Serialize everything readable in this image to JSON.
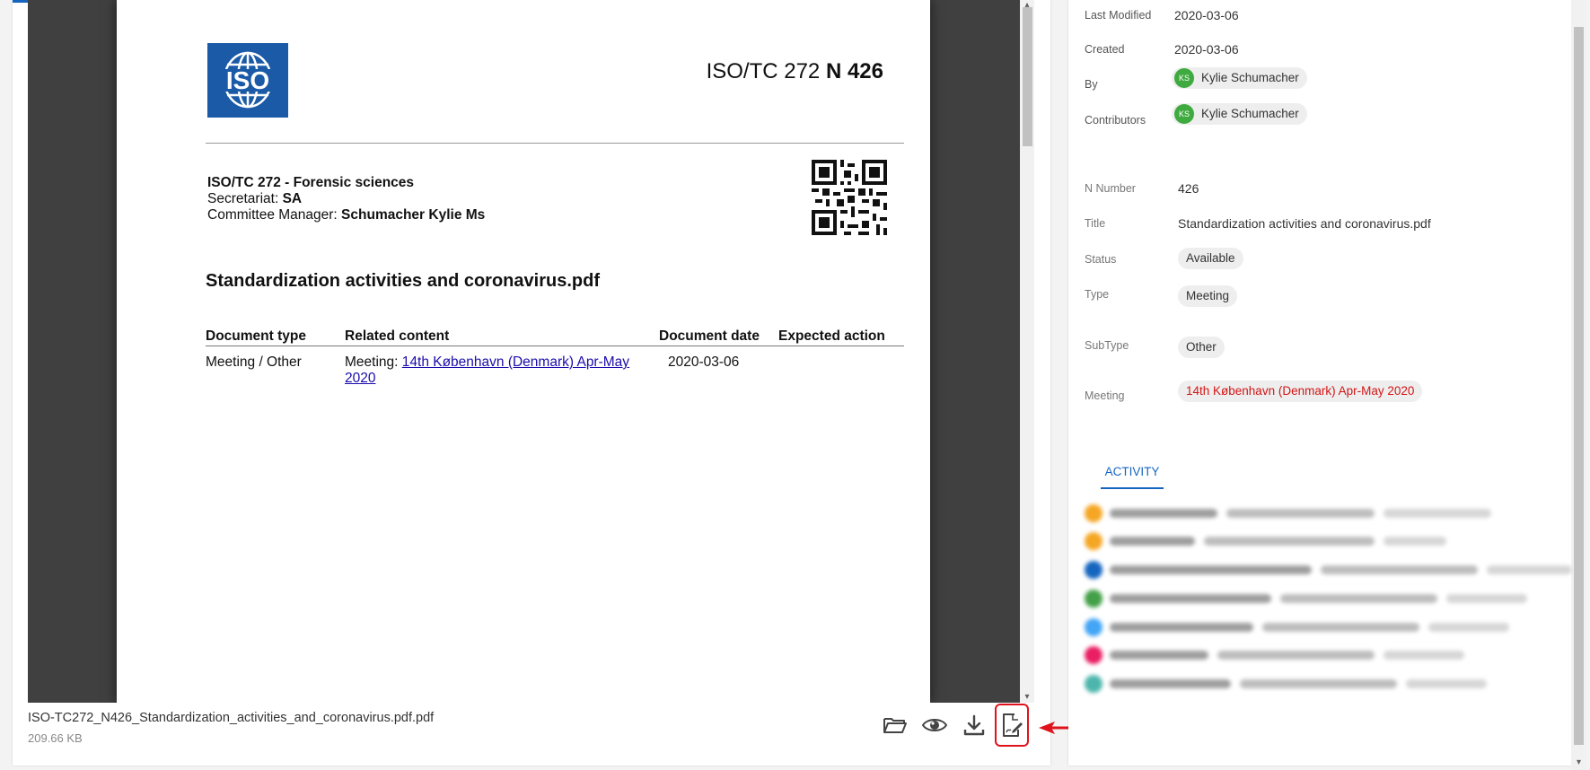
{
  "pdf": {
    "logo_text": "ISO",
    "doc_ref_prefix": "ISO/TC 272",
    "doc_ref_number": "N 426",
    "committee_line": "ISO/TC 272 - Forensic sciences",
    "secretariat_label": "Secretariat:",
    "secretariat_value": "SA",
    "manager_label": "Committee Manager:",
    "manager_value": "Schumacher Kylie Ms",
    "title": "Standardization activities and coronavirus.pdf",
    "table": {
      "headers": [
        "Document type",
        "Related content",
        "Document date",
        "Expected action"
      ],
      "row": {
        "doc_type": "Meeting / Other",
        "related_prefix": "Meeting:",
        "related_link": "14th København (Denmark) Apr-May 2020",
        "doc_date": "2020-03-06",
        "expected_action": ""
      }
    }
  },
  "file": {
    "name": "ISO-TC272_N426_Standardization_activities_and_coronavirus.pdf.pdf",
    "size": "209.66 KB"
  },
  "details": {
    "last_modified_label": "Last Modified",
    "last_modified_value": "2020-03-06",
    "created_label": "Created",
    "created_value": "2020-03-06",
    "by_label": "By",
    "by_initials": "KS",
    "by_name": "Kylie Schumacher",
    "contributors_label": "Contributors",
    "contributors_initials": "KS",
    "contributors_name": "Kylie Schumacher",
    "n_number_label": "N Number",
    "n_number_value": "426",
    "title_label": "Title",
    "title_value": "Standardization activities and coronavirus.pdf",
    "status_label": "Status",
    "status_value": "Available",
    "type_label": "Type",
    "type_value": "Meeting",
    "subtype_label": "SubType",
    "subtype_value": "Other",
    "meeting_label": "Meeting",
    "meeting_value": "14th København (Denmark) Apr-May 2020"
  },
  "activity": {
    "tab_label": "ACTIVITY"
  },
  "colors": {
    "accent": "#1565c0",
    "highlight_red": "#e0121b",
    "avatar_green": "#3faa3f",
    "meeting_red": "#d21515"
  }
}
